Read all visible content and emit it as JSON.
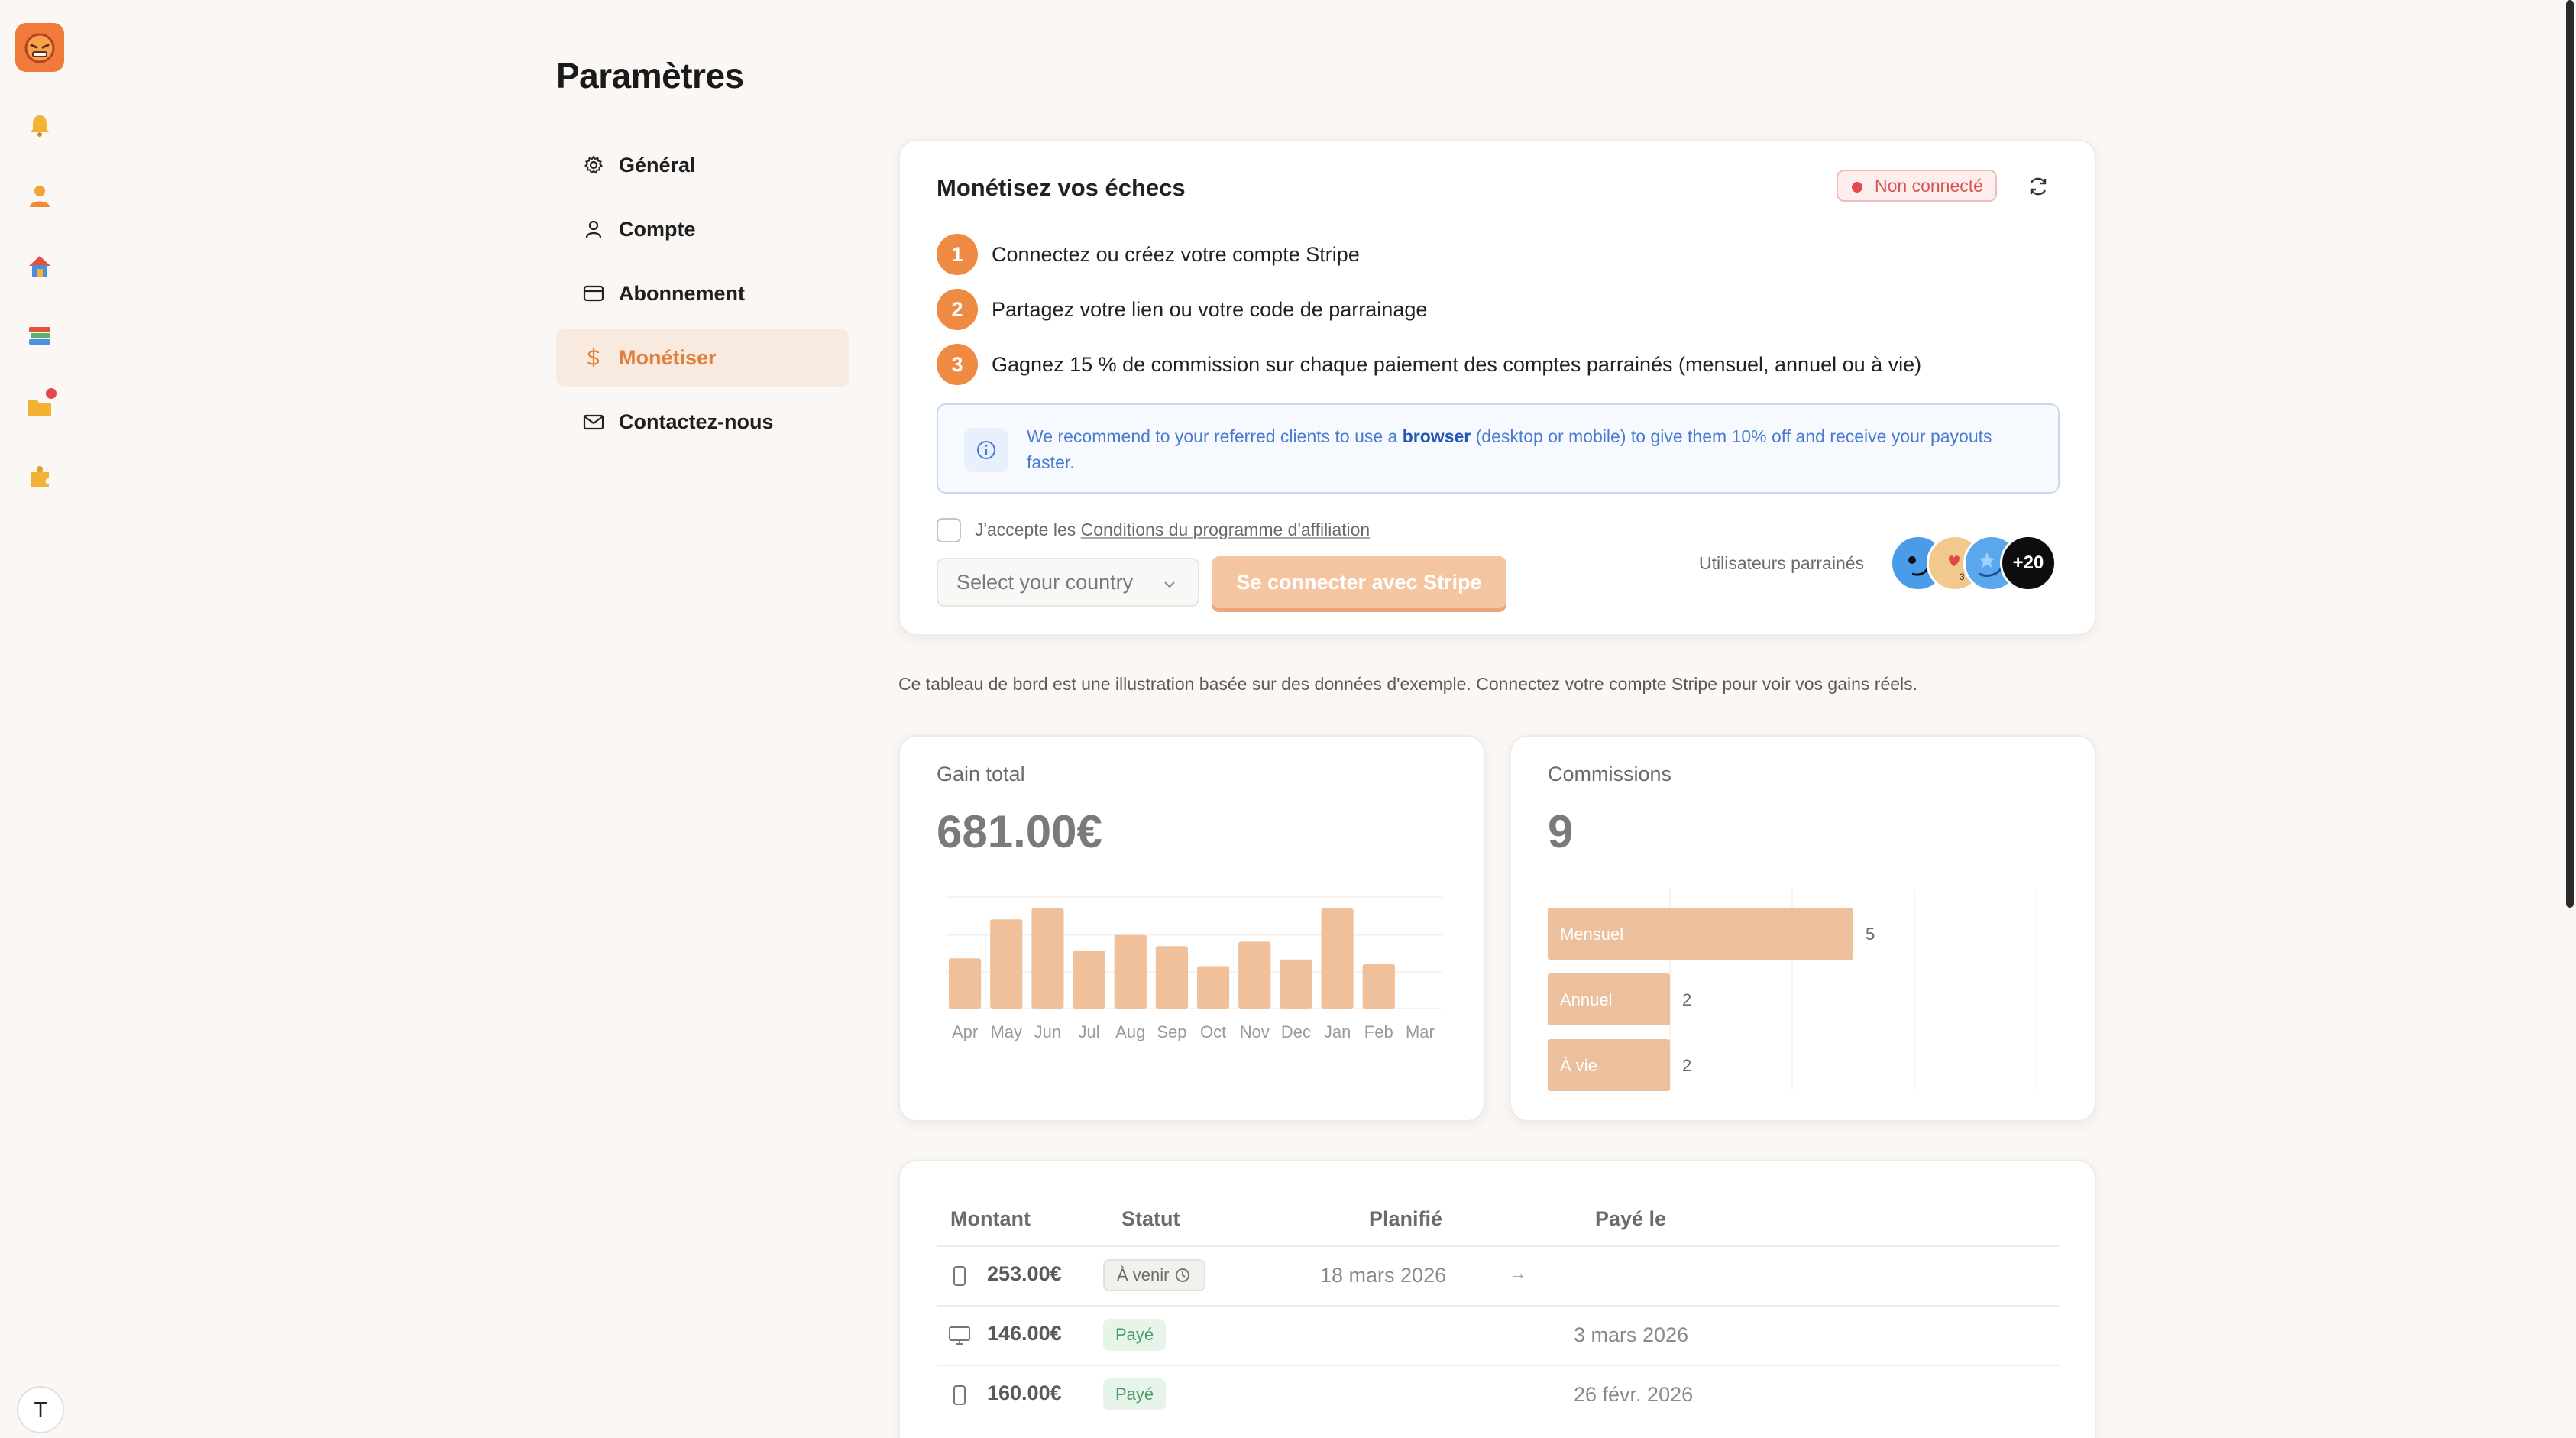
{
  "rail": {
    "items": [
      {
        "icon": "bell-icon"
      },
      {
        "icon": "user-icon"
      },
      {
        "icon": "home-icon"
      },
      {
        "icon": "books-icon"
      },
      {
        "icon": "folder-icon",
        "notification": true
      },
      {
        "icon": "puzzle-icon"
      }
    ],
    "avatar_initial": "T"
  },
  "page": {
    "title": "Paramètres"
  },
  "menu": {
    "items": [
      {
        "label": "Général",
        "icon": "gear-icon"
      },
      {
        "label": "Compte",
        "icon": "user-icon"
      },
      {
        "label": "Abonnement",
        "icon": "credit-card-icon"
      },
      {
        "label": "Monétiser",
        "icon": "dollar-icon",
        "active": true
      },
      {
        "label": "Contactez-nous",
        "icon": "mail-icon"
      }
    ]
  },
  "monetize": {
    "title": "Monétisez vos échecs",
    "status_badge": "Non connecté",
    "steps": [
      {
        "num": "1",
        "text": "Connectez ou créez votre compte Stripe"
      },
      {
        "num": "2",
        "text": "Partagez votre lien ou votre code de parrainage"
      },
      {
        "num": "3",
        "text": "Gagnez 15 % de commission sur chaque paiement des comptes parrainés (mensuel, annuel ou à vie)"
      }
    ],
    "info": {
      "before": "We recommend to your referred clients to use a ",
      "bold": "browser",
      "after": " (desktop or mobile) to give them 10% off and receive your payouts faster."
    },
    "terms_prefix": "J'accepte les ",
    "terms_link": "Conditions du programme d'affiliation",
    "country_placeholder": "Select your country",
    "stripe_button": "Se connecter avec Stripe",
    "referred_label": "Utilisateurs parrainés",
    "referred_more": "+20"
  },
  "disclaimer": "Ce tableau de bord est une illustration basée sur des données d'exemple. Connectez votre compte Stripe pour voir vos gains réels.",
  "gain": {
    "label": "Gain total",
    "value": "681.00€"
  },
  "commissions": {
    "label": "Commissions",
    "value": "9"
  },
  "chart_data": [
    {
      "type": "bar",
      "categories": [
        "Apr",
        "May",
        "Jun",
        "Jul",
        "Aug",
        "Sep",
        "Oct",
        "Nov",
        "Dec",
        "Jan",
        "Feb",
        "Mar"
      ],
      "values": [
        45,
        80,
        90,
        52,
        66,
        56,
        38,
        60,
        44,
        90,
        40,
        0
      ],
      "title": "Gain total",
      "color": "#f0c09a"
    },
    {
      "type": "bar",
      "orientation": "horizontal",
      "categories": [
        "Mensuel",
        "Annuel",
        "À vie"
      ],
      "values": [
        5,
        2,
        2
      ],
      "xlim": [
        0,
        8
      ],
      "title": "Commissions",
      "color": "#ecc09c"
    }
  ],
  "table": {
    "headers": {
      "amount": "Montant",
      "status": "Statut",
      "planned": "Planifié",
      "paid_on": "Payé le"
    },
    "rows": [
      {
        "icon": "mobile-icon",
        "amount": "253.00€",
        "status": "À venir",
        "status_type": "upcoming",
        "planned": "18 mars 2026",
        "arrow": "→",
        "paid_on": ""
      },
      {
        "icon": "desktop-icon",
        "amount": "146.00€",
        "status": "Payé",
        "status_type": "paid",
        "planned": "",
        "arrow": "",
        "paid_on": "3 mars 2026"
      },
      {
        "icon": "mobile-icon",
        "amount": "160.00€",
        "status": "Payé",
        "status_type": "paid",
        "planned": "",
        "arrow": "",
        "paid_on": "26 févr. 2026"
      }
    ]
  }
}
